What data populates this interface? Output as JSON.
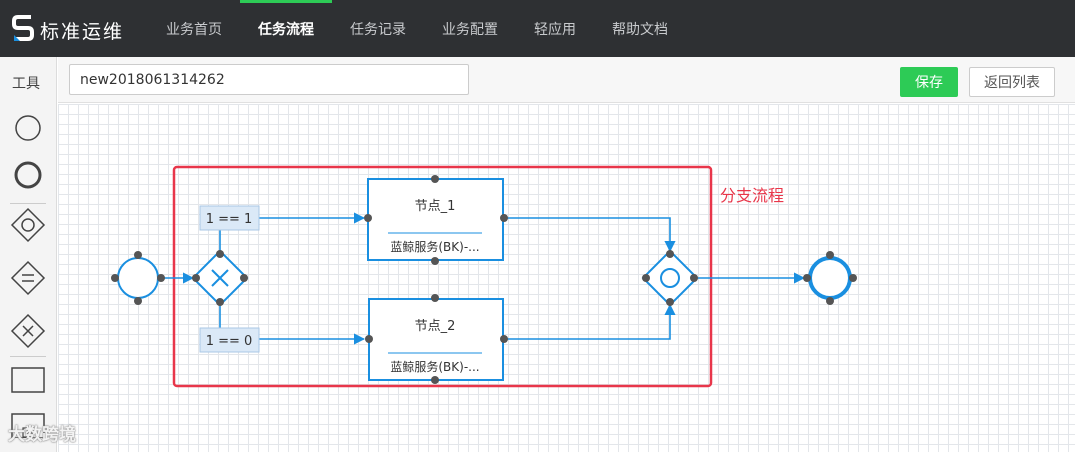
{
  "app": {
    "title": "标准运维"
  },
  "nav": {
    "items": [
      "业务首页",
      "任务流程",
      "任务记录",
      "业务配置",
      "轻应用",
      "帮助文档"
    ],
    "active": "任务流程"
  },
  "toolbar": {
    "title": "工具"
  },
  "header": {
    "flow_name": "new2018061314262",
    "save_label": "保存",
    "back_label": "返回列表"
  },
  "diagram": {
    "group_label": "分支流程",
    "nodes": [
      {
        "title": "节点_1",
        "subtitle": "蓝鲸服务(BK)-..."
      },
      {
        "title": "节点_2",
        "subtitle": "蓝鲸服务(BK)-..."
      }
    ],
    "conditions": [
      "1 == 1",
      "1 == 0"
    ]
  },
  "watermark": "大数跨境",
  "colors": {
    "accent": "#2dcb56",
    "flow": "#1a8fe0",
    "group_border": "#e8364a",
    "topbar": "#2e3033"
  }
}
